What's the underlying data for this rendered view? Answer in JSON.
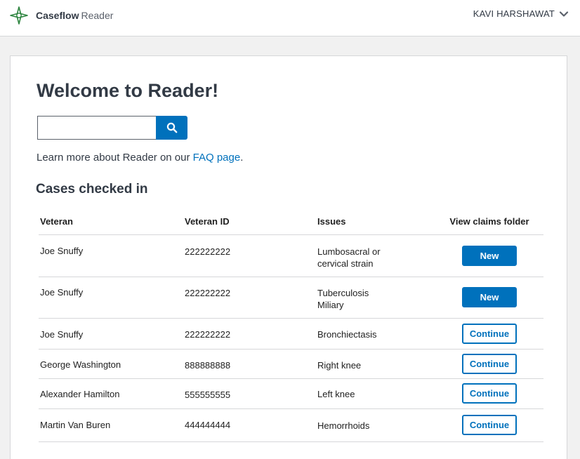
{
  "header": {
    "app_name": "Caseflow",
    "app_sub": "Reader",
    "user_name": "KAVI HARSHAWAT"
  },
  "main": {
    "title": "Welcome to Reader!",
    "search": {
      "value": "",
      "placeholder": ""
    },
    "faq": {
      "prefix": "Learn more about Reader on our ",
      "link": "FAQ page",
      "suffix": "."
    },
    "section_title": "Cases checked in",
    "table": {
      "headers": [
        "Veteran",
        "Veteran ID",
        "Issues",
        "View claims folder"
      ],
      "rows": [
        {
          "veteran": "Joe Snuffy",
          "veteran_id": "222222222",
          "issue_line1": "Lumbosacral or",
          "issue_line2": "cervical strain",
          "action": "New"
        },
        {
          "veteran": "Joe Snuffy",
          "veteran_id": "222222222",
          "issue_line1": "Tuberculosis",
          "issue_line2": "Miliary",
          "action": "New"
        },
        {
          "veteran": "Joe Snuffy",
          "veteran_id": "222222222",
          "issue_line1": "Bronchiectasis",
          "issue_line2": "",
          "action": "Continue"
        },
        {
          "veteran": "George Washington",
          "veteran_id": "888888888",
          "issue_line1": "Right knee",
          "issue_line2": "",
          "action": "Continue"
        },
        {
          "veteran": "Alexander Hamilton",
          "veteran_id": "555555555",
          "issue_line1": "Left knee",
          "issue_line2": "",
          "action": "Continue"
        },
        {
          "veteran": "Martin Van Buren",
          "veteran_id": "444444444",
          "issue_line1": "Hemorrhoids",
          "issue_line2": "",
          "action": "Continue"
        }
      ]
    }
  },
  "icons": {
    "logo": "caseflow-logo-icon",
    "dropdown": "chevron-down-icon",
    "search": "search-icon"
  },
  "colors": {
    "primary": "#0071bc",
    "heading": "#323a45",
    "logo_green": "#2e8540",
    "border": "#d6d7d9",
    "background": "#f1f1f1"
  }
}
